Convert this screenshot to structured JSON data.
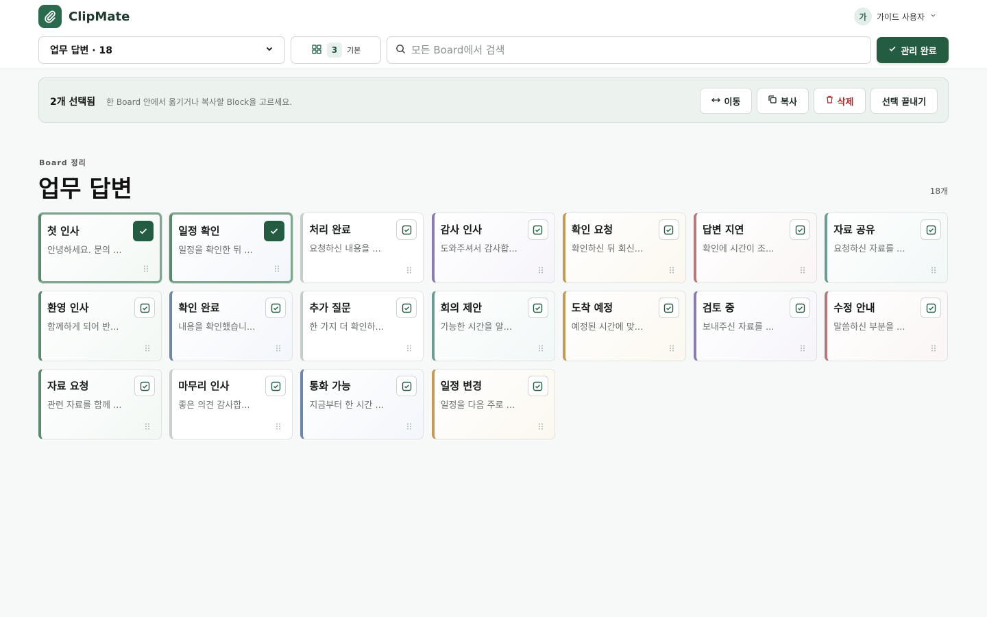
{
  "app": {
    "name": "ClipMate"
  },
  "user": {
    "initial": "가",
    "name": "가이드 사용자"
  },
  "toolbar": {
    "board_select": "업무 답변 · 18",
    "view_count": "3",
    "view_label": "기본",
    "search_placeholder": "모든 Board에서 검색",
    "done_label": "관리 완료"
  },
  "selection": {
    "count_label": "2개 선택됨",
    "hint": "한 Board 안에서 옮기거나 복사할 Block을 고르세요.",
    "move_label": "이동",
    "copy_label": "복사",
    "delete_label": "삭제",
    "exit_label": "선택 끝내기"
  },
  "board": {
    "eyebrow": "Board 정리",
    "title": "업무 답변",
    "count": "18개"
  },
  "colors": {
    "brand": "#245c41",
    "green": "#5a8a6e",
    "blue": "#6f86ad",
    "purple": "#8a7bb0",
    "amber": "#c49a55",
    "red": "#b87878",
    "teal": "#6b9e93",
    "gray": "#c8ceca"
  },
  "cards": [
    {
      "title": "첫 인사",
      "snippet": "안녕하세요. 문의 ...",
      "accent": "green",
      "selected": true
    },
    {
      "title": "일정 확인",
      "snippet": "일정을 확인한 뒤 ...",
      "accent": "blue",
      "selected": true
    },
    {
      "title": "처리 완료",
      "snippet": "요청하신 내용을 ...",
      "accent": "gray",
      "selected": false
    },
    {
      "title": "감사 인사",
      "snippet": "도와주셔서 감사합...",
      "accent": "purple",
      "selected": false
    },
    {
      "title": "확인 요청",
      "snippet": "확인하신 뒤 회신...",
      "accent": "amber",
      "selected": false
    },
    {
      "title": "답변 지연",
      "snippet": "확인에 시간이 조...",
      "accent": "red",
      "selected": false
    },
    {
      "title": "자료 공유",
      "snippet": "요청하신 자료를 ...",
      "accent": "teal",
      "selected": false
    },
    {
      "title": "환영 인사",
      "snippet": "함께하게 되어 반...",
      "accent": "green",
      "selected": false
    },
    {
      "title": "확인 완료",
      "snippet": "내용을 확인했습니...",
      "accent": "blue",
      "selected": false
    },
    {
      "title": "추가 질문",
      "snippet": "한 가지 더 확인하...",
      "accent": "gray",
      "selected": false
    },
    {
      "title": "회의 제안",
      "snippet": "가능한 시간을 알...",
      "accent": "teal",
      "selected": false
    },
    {
      "title": "도착 예정",
      "snippet": "예정된 시간에 맞...",
      "accent": "amber",
      "selected": false
    },
    {
      "title": "검토 중",
      "snippet": "보내주신 자료를 ...",
      "accent": "purple",
      "selected": false
    },
    {
      "title": "수정 안내",
      "snippet": "말씀하신 부분을 ...",
      "accent": "red",
      "selected": false
    },
    {
      "title": "자료 요청",
      "snippet": "관련 자료를 함께 ...",
      "accent": "green",
      "selected": false
    },
    {
      "title": "마무리 인사",
      "snippet": "좋은 의견 감사합...",
      "accent": "gray",
      "selected": false
    },
    {
      "title": "통화 가능",
      "snippet": "지금부터 한 시간 ...",
      "accent": "blue",
      "selected": false
    },
    {
      "title": "일정 변경",
      "snippet": "일정을 다음 주로 ...",
      "accent": "amber",
      "selected": false
    }
  ]
}
